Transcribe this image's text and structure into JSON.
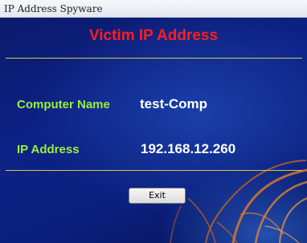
{
  "window": {
    "title": "IP Address Spyware"
  },
  "main": {
    "heading": "Victim IP Address",
    "computer_name_label": "Computer Name",
    "computer_name_value": "test-Comp",
    "ip_address_label": "IP Address",
    "ip_address_value": "192.168.12.260",
    "exit_label": "Exit"
  },
  "colors": {
    "heading": "#ff1e1e",
    "labels": "#9bf03a",
    "values": "#ffffff",
    "rules": "#d9c94a",
    "background": "#0d2287"
  }
}
